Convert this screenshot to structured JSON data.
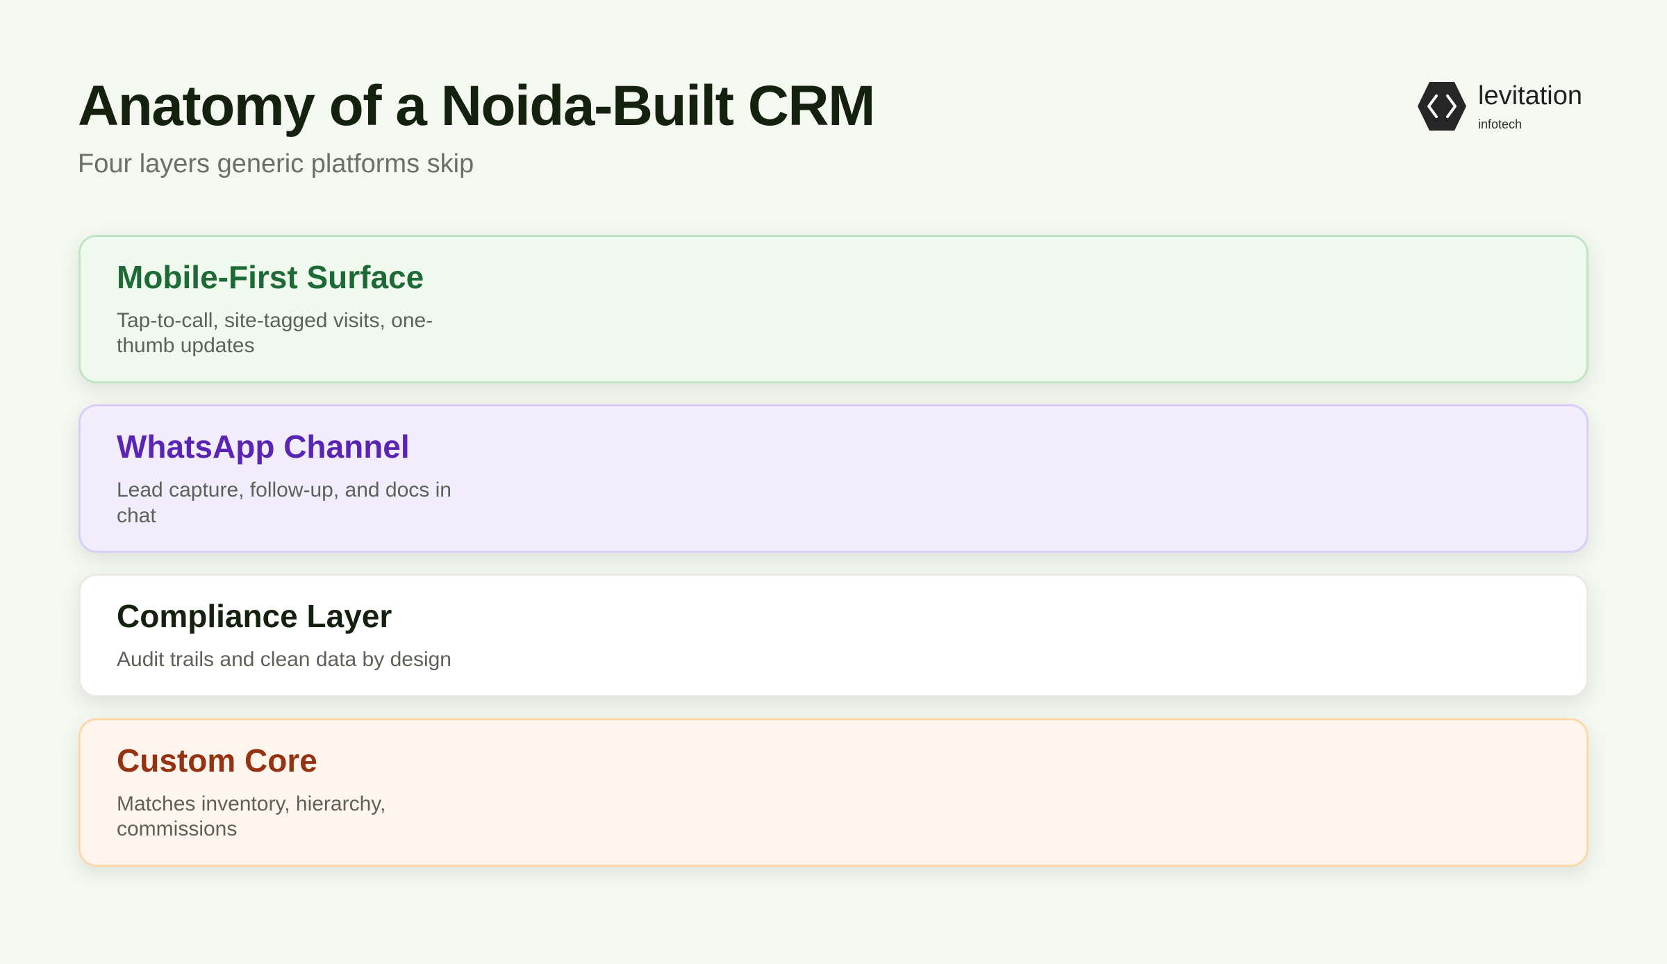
{
  "header": {
    "title": "Anatomy of a Noida-Built CRM",
    "subtitle": "Four layers generic platforms skip"
  },
  "brand": {
    "name": "levitation",
    "tagline": "infotech",
    "icon": "hexagon-code-logo",
    "color": "#262626"
  },
  "layers": [
    {
      "title": "Mobile-First Surface",
      "description": "Tap-to-call, site-tagged visits, one-thumb updates",
      "accent": "#1e6a36",
      "background": "#eff9ee"
    },
    {
      "title": "WhatsApp Channel",
      "description": "Lead capture, follow-up, and docs in chat",
      "accent": "#5a25b4",
      "background": "#f2edfd"
    },
    {
      "title": "Compliance Layer",
      "description": "Audit trails and clean data by design",
      "accent": "#15210f",
      "background": "#ffffff"
    },
    {
      "title": "Custom Core",
      "description": "Matches inventory, hierarchy, commissions",
      "accent": "#943212",
      "background": "#fff5ec"
    }
  ]
}
